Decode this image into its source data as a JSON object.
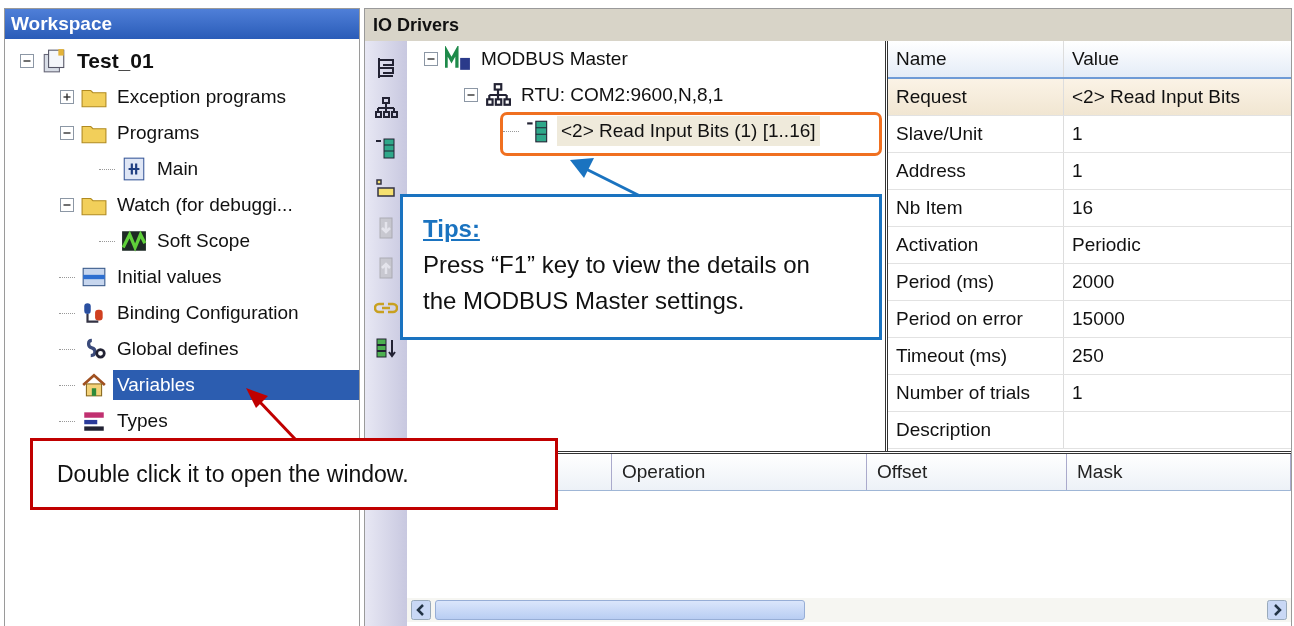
{
  "workspace": {
    "title": "Workspace",
    "tree": [
      {
        "label": "Test_01",
        "kind": "project",
        "expanded": true,
        "selected": false,
        "children": [
          {
            "label": "Exception programs",
            "kind": "folder",
            "expanded": false,
            "selected": false
          },
          {
            "label": "Programs",
            "kind": "folder",
            "expanded": true,
            "selected": false,
            "children": [
              {
                "label": "Main",
                "kind": "program",
                "selected": false
              }
            ]
          },
          {
            "label": "Watch (for debuggi...",
            "kind": "folder",
            "expanded": true,
            "selected": false,
            "children": [
              {
                "label": "Soft Scope",
                "kind": "scope",
                "selected": false
              }
            ]
          },
          {
            "label": "Initial values",
            "kind": "table",
            "selected": false
          },
          {
            "label": "Binding Configuration",
            "kind": "binding",
            "selected": false
          },
          {
            "label": "Global defines",
            "kind": "defines",
            "selected": false
          },
          {
            "label": "Variables",
            "kind": "house",
            "selected": true
          },
          {
            "label": "Types",
            "kind": "types",
            "selected": false
          }
        ]
      }
    ]
  },
  "io_drivers": {
    "title": "IO Drivers",
    "toolbar": [
      {
        "kind": "tree",
        "disabled": false
      },
      {
        "kind": "network",
        "disabled": false
      },
      {
        "kind": "request",
        "disabled": false
      },
      {
        "kind": "link",
        "disabled": false
      },
      {
        "kind": "down",
        "disabled": true
      },
      {
        "kind": "up",
        "disabled": true
      },
      {
        "kind": "chain",
        "disabled": false
      },
      {
        "kind": "sort",
        "disabled": false
      }
    ],
    "tree": [
      {
        "label": "MODBUS Master",
        "kind": "master",
        "expanded": true,
        "selected": false,
        "children": [
          {
            "label": "RTU: COM2:9600,N,8,1",
            "kind": "network",
            "expanded": true,
            "selected": false,
            "children": [
              {
                "label": "<2> Read Input Bits (1) [1..16]",
                "kind": "request",
                "selected": true
              }
            ]
          }
        ]
      }
    ],
    "properties": {
      "columns": [
        "Name",
        "Value"
      ],
      "rows": [
        {
          "name": "Request",
          "value": "<2> Read Input Bits",
          "selected": true
        },
        {
          "name": "Slave/Unit",
          "value": "1",
          "selected": false
        },
        {
          "name": "Address",
          "value": "1",
          "selected": false
        },
        {
          "name": "Nb Item",
          "value": "16",
          "selected": false
        },
        {
          "name": "Activation",
          "value": "Periodic",
          "selected": false
        },
        {
          "name": "Period (ms)",
          "value": "2000",
          "selected": false
        },
        {
          "name": "Period on error",
          "value": "15000",
          "selected": false
        },
        {
          "name": "Timeout (ms)",
          "value": "250",
          "selected": false
        },
        {
          "name": "Number of trials",
          "value": "1",
          "selected": false
        },
        {
          "name": "Description",
          "selected": false
        }
      ]
    },
    "variables_grid": {
      "columns": [
        "Operation",
        "Offset",
        "Mask"
      ]
    }
  },
  "callouts": {
    "tips": {
      "title": "Tips:",
      "text": "Press “F1” key to view the details on the MODBUS Master settings."
    },
    "note": {
      "text": "Double click it to open the window."
    }
  }
}
